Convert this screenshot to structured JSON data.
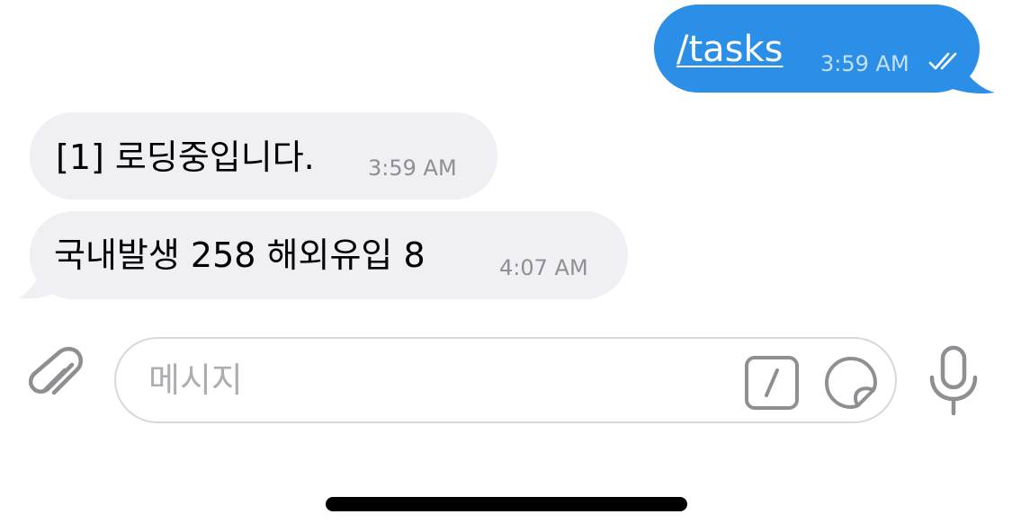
{
  "outgoing_message": {
    "text": "/tasks",
    "time": "3:59 AM",
    "bubble_color": "#2c8fe7",
    "status_icon": "double-check-icon"
  },
  "incoming_messages": [
    {
      "text": "[1] 로딩중입니다.",
      "time": "3:59 AM"
    },
    {
      "text": "국내발생 258 해외유입 8",
      "time": "4:07 AM"
    }
  ],
  "composer": {
    "placeholder": "메시지",
    "attach_icon": "paperclip-icon",
    "command_icon": "slash-command-icon",
    "sticker_icon": "sticker-icon",
    "mic_icon": "microphone-icon"
  },
  "colors": {
    "incoming_bubble": "#efeff4",
    "icon_gray": "#8e8e93"
  }
}
